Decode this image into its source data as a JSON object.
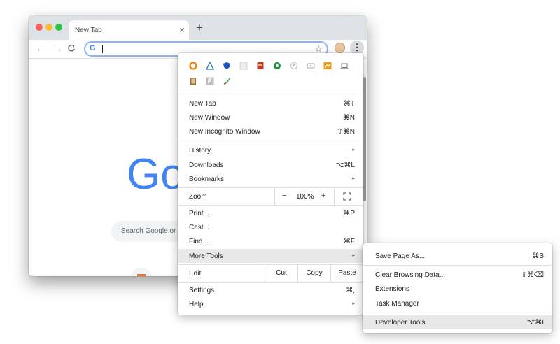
{
  "tab": {
    "title": "New Tab",
    "close": "×",
    "new_tab": "+"
  },
  "nav": {
    "back": "←",
    "forward": "→",
    "reload": "C"
  },
  "omnibox": {
    "g": "G",
    "star": "☆",
    "value": ""
  },
  "toolbar": {
    "menu": "⋮"
  },
  "page": {
    "logo_part1": "Go",
    "logo_part2": "o",
    "search_placeholder": "Search Google or"
  },
  "menu": {
    "extension_icons_row1": [
      "ext-orange-ring-icon",
      "ext-blue-triangle-icon",
      "ext-shield-icon",
      "ext-blank-icon",
      "ext-red-box-icon",
      "ext-green-circle-icon",
      "ext-tag-icon",
      "ext-gray-badge-icon",
      "ext-orange-chart-icon",
      "ext-laptop-icon"
    ],
    "extension_icons_row2": [
      "ext-notebook-icon",
      "ext-letter-f-icon",
      "ext-rocket-icon"
    ],
    "items_top": [
      {
        "label": "New Tab",
        "shortcut": "⌘T"
      },
      {
        "label": "New Window",
        "shortcut": "⌘N"
      },
      {
        "label": "New Incognito Window",
        "shortcut": "⇧⌘N"
      }
    ],
    "items_mid": [
      {
        "label": "History",
        "shortcut": "▸"
      },
      {
        "label": "Downloads",
        "shortcut": "⌥⌘L"
      },
      {
        "label": "Bookmarks",
        "shortcut": "▸"
      }
    ],
    "zoom": {
      "label": "Zoom",
      "minus": "−",
      "value": "100%",
      "plus": "+"
    },
    "items_lower": [
      {
        "label": "Print...",
        "shortcut": "⌘P"
      },
      {
        "label": "Cast...",
        "shortcut": ""
      },
      {
        "label": "Find...",
        "shortcut": "⌘F"
      },
      {
        "label": "More Tools",
        "shortcut": "▸"
      }
    ],
    "edit": {
      "label": "Edit",
      "cut": "Cut",
      "copy": "Copy",
      "paste": "Paste"
    },
    "items_bottom": [
      {
        "label": "Settings",
        "shortcut": "⌘,"
      },
      {
        "label": "Help",
        "shortcut": "▸"
      }
    ]
  },
  "submenu": {
    "items": [
      {
        "label": "Save Page As...",
        "shortcut": "⌘S"
      },
      {
        "label": "Clear Browsing Data...",
        "shortcut": "⇧⌘⌫"
      },
      {
        "label": "Extensions",
        "shortcut": ""
      },
      {
        "label": "Task Manager",
        "shortcut": ""
      },
      {
        "label": "Developer Tools",
        "shortcut": "⌥⌘I"
      }
    ]
  }
}
